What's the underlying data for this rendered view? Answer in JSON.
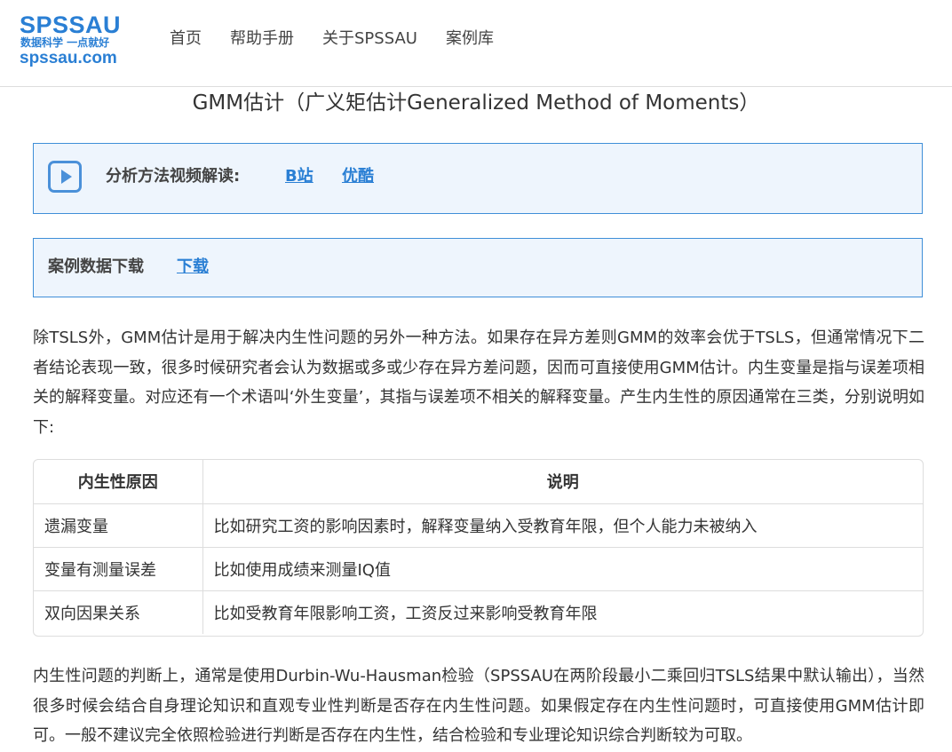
{
  "header": {
    "logo": {
      "main": "SPSSAU",
      "slogan": "数据科学 一点就好",
      "url": "spssau.com"
    },
    "nav": [
      "首页",
      "帮助手册",
      "关于SPSSAU",
      "案例库"
    ]
  },
  "page": {
    "title": "GMM估计（广义矩估计Generalized Method of Moments）"
  },
  "video_box": {
    "icon": "play-icon",
    "label": "分析方法视频解读:",
    "links": [
      "B站",
      "优酷"
    ]
  },
  "data_box": {
    "label": "案例数据下载",
    "link": "下载"
  },
  "paragraphs": {
    "intro": "除TSLS外，GMM估计是用于解决内生性问题的另外一种方法。如果存在异方差则GMM的效率会优于TSLS，但通常情况下二者结论表现一致，很多时候研究者会认为数据或多或少存在异方差问题，因而可直接使用GMM估计。内生变量是指与误差项相关的解释变量。对应还有一个术语叫‘外生变量’，其指与误差项不相关的解释变量。产生内生性的原因通常在三类，分别说明如下:",
    "judgement": "内生性问题的判断上，通常是使用Durbin-Wu-Hausman检验（SPSSAU在两阶段最小二乘回归TSLS结果中默认输出），当然很多时候会结合自身理论知识和直观专业性判断是否存在内生性问题。如果假定存在内生性问题时，可直接使用GMM估计即可。一般不建议完全依照检验进行判断是否存在内生性，结合检验和专业理论知识综合判断较为可取。"
  },
  "table": {
    "headers": [
      "内生性原因",
      "说明"
    ],
    "rows": [
      [
        "遗漏变量",
        "比如研究工资的影响因素时，解释变量纳入受教育年限，但个人能力未被纳入"
      ],
      [
        "变量有测量误差",
        "比如使用成绩来测量IQ值"
      ],
      [
        "双向因果关系",
        "比如受教育年限影响工资，工资反过来影响受教育年限"
      ]
    ]
  },
  "colors": {
    "brand": "#2a7fd4",
    "box_background": "#eef5fd",
    "box_border": "#3f8fd8",
    "text": "#333333"
  }
}
